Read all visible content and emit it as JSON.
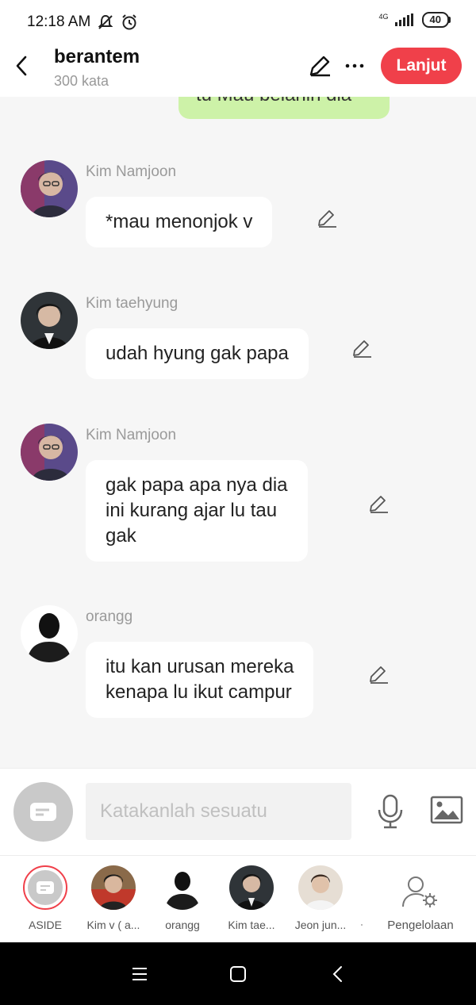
{
  "status_bar": {
    "time": "12:18 AM",
    "network": "4G",
    "battery": "40"
  },
  "header": {
    "title": "berantem",
    "subtitle": "300 kata",
    "next_button": "Lanjut"
  },
  "previous_message": {
    "text": "tu Mau belahin dia"
  },
  "messages": [
    {
      "name": "Kim Namjoon",
      "lines": [
        "*mau menonjok v"
      ]
    },
    {
      "name": "Kim taehyung",
      "lines": [
        "udah hyung gak papa"
      ]
    },
    {
      "name": "Kim Namjoon",
      "lines": [
        "gak papa apa nya dia",
        "ini kurang ajar lu tau",
        "gak"
      ]
    },
    {
      "name": "orangg",
      "lines": [
        "itu kan urusan mereka",
        "kenapa lu ikut campur"
      ]
    }
  ],
  "input": {
    "placeholder": "Katakanlah sesuatu"
  },
  "characters": [
    {
      "label": "ASIDE"
    },
    {
      "label": "Kim v ( a..."
    },
    {
      "label": "orangg"
    },
    {
      "label": "Kim tae..."
    },
    {
      "label": "Jeon jun..."
    }
  ],
  "management": {
    "label": "Pengelolaan"
  },
  "colors": {
    "accent": "#f0404a",
    "sent_bubble": "#cdf2a8",
    "background": "#f6f6f6"
  }
}
